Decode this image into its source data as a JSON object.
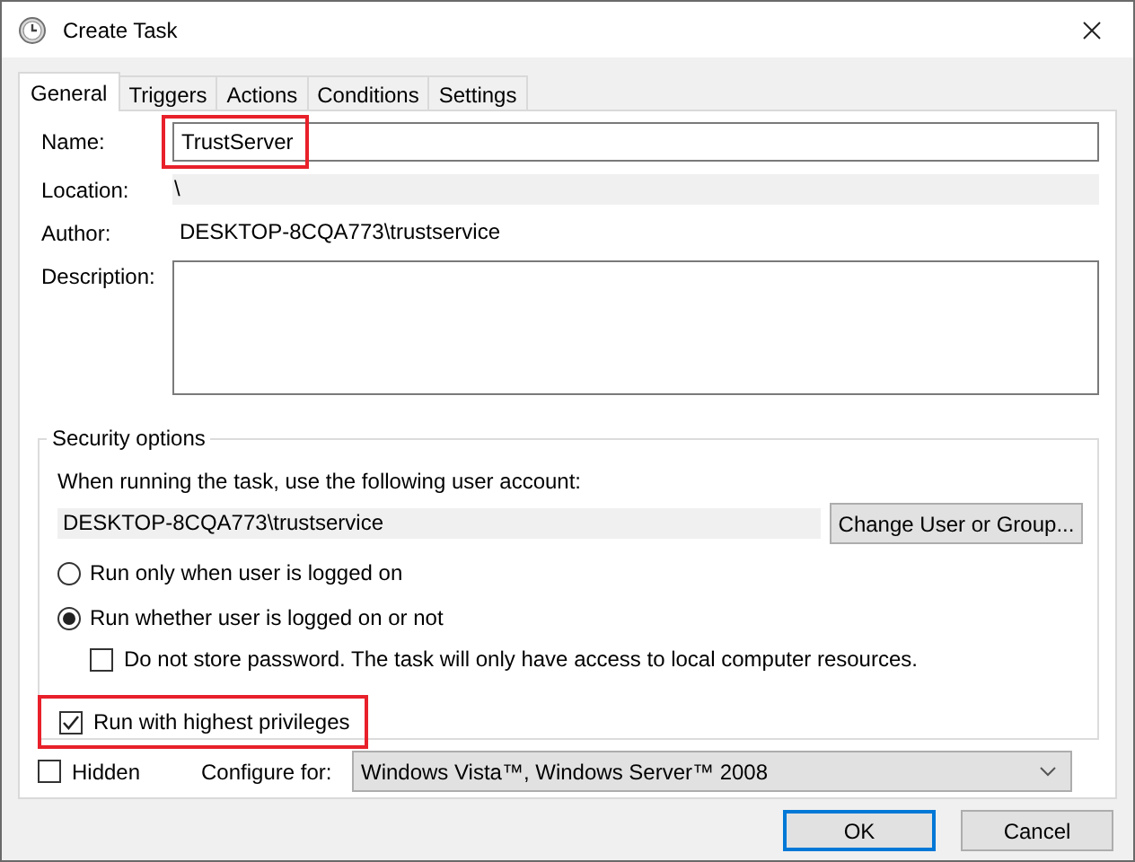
{
  "window": {
    "title": "Create Task"
  },
  "tabs": [
    {
      "label": "General",
      "selected": true
    },
    {
      "label": "Triggers",
      "selected": false
    },
    {
      "label": "Actions",
      "selected": false
    },
    {
      "label": "Conditions",
      "selected": false
    },
    {
      "label": "Settings",
      "selected": false
    }
  ],
  "name": {
    "label": "Name:",
    "value": "TrustServer",
    "highlighted": true
  },
  "location": {
    "label": "Location:",
    "value": "\\"
  },
  "author": {
    "label": "Author:",
    "value": "DESKTOP-8CQA773\\trustservice"
  },
  "description": {
    "label": "Description:"
  },
  "security": {
    "title": "Security options",
    "prompt": "When running the task, use the following user account:",
    "account": "DESKTOP-8CQA773\\trustservice",
    "change_button": "Change User or Group...",
    "options": [
      {
        "kind": "radio",
        "label": "Run only when user is logged on",
        "selected": false,
        "highlighted": false
      },
      {
        "kind": "radio",
        "label": "Run whether user is logged on or not",
        "selected": true,
        "highlighted": false
      },
      {
        "kind": "subcheck",
        "label": "Do not store password.  The task will only have access to local computer resources.",
        "checked": false,
        "highlighted": false
      },
      {
        "kind": "checkbox",
        "label": "Run with highest privileges",
        "checked": true,
        "highlighted": true
      }
    ]
  },
  "hidden": {
    "label": "Hidden",
    "checked": false
  },
  "configure": {
    "label": "Configure for:",
    "value": "Windows Vista™, Windows Server™ 2008"
  },
  "buttons": [
    {
      "label": "OK",
      "default": true
    },
    {
      "label": "Cancel",
      "default": false
    }
  ]
}
